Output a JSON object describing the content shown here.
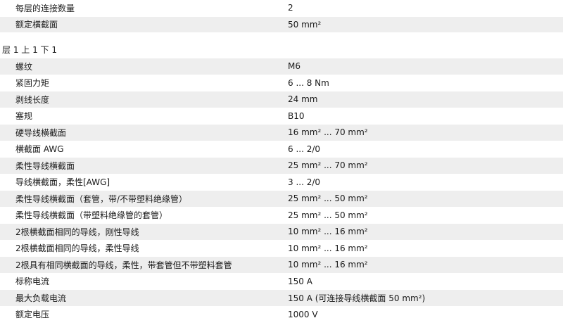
{
  "top_rows": [
    {
      "label": "每层的连接数量",
      "value": "2"
    },
    {
      "label": "额定横截面",
      "value": "50 mm²"
    }
  ],
  "section_title": "层 1 上 1 下 1",
  "rows": [
    {
      "label": "螺纹",
      "value": "M6"
    },
    {
      "label": "紧固力矩",
      "value": "6 ... 8 Nm"
    },
    {
      "label": "剥线长度",
      "value": "24 mm"
    },
    {
      "label": "塞规",
      "value": "B10"
    },
    {
      "label": "硬导线横截面",
      "value": "16 mm² ... 70 mm²"
    },
    {
      "label": "横截面 AWG",
      "value": "6 ... 2/0"
    },
    {
      "label": "柔性导线横截面",
      "value": "25 mm² ... 70 mm²"
    },
    {
      "label": "导线横截面，柔性[AWG]",
      "value": "3 ... 2/0"
    },
    {
      "label": "柔性导线横截面（套管，带/不带塑料绝缘管）",
      "value": "25 mm² ... 50 mm²"
    },
    {
      "label": "柔性导线横截面（带塑料绝缘管的套管）",
      "value": "25 mm² ... 50 mm²"
    },
    {
      "label": "2根横截面相同的导线，刚性导线",
      "value": "10 mm² ... 16 mm²"
    },
    {
      "label": "2根横截面相同的导线，柔性导线",
      "value": "10 mm² ... 16 mm²"
    },
    {
      "label": "2根具有相同横截面的导线，柔性，带套管但不带塑料套管",
      "value": "10 mm² ... 16 mm²"
    },
    {
      "label": "标称电流",
      "value": "150 A"
    },
    {
      "label": "最大负载电流",
      "value": "150 A (可连接导线横截面 50 mm²)"
    },
    {
      "label": "额定电压",
      "value": "1000 V"
    }
  ]
}
